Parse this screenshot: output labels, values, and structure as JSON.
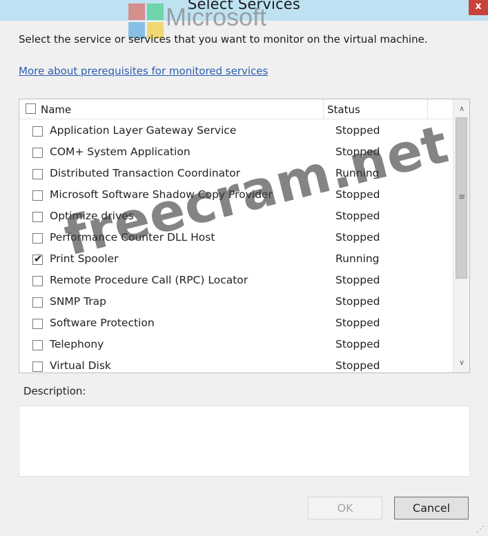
{
  "window": {
    "title": "Select Services"
  },
  "logo": {
    "wordmark": "Microsoft"
  },
  "prompt_text": "Select the service or services that you want to monitor on the virtual machine.",
  "prereq_link": "More about prerequisites for monitored services",
  "list": {
    "columns": {
      "name": "Name",
      "status": "Status"
    },
    "rows": [
      {
        "name": "Application Layer Gateway Service",
        "status": "Stopped",
        "checked": false
      },
      {
        "name": "COM+ System Application",
        "status": "Stopped",
        "checked": false
      },
      {
        "name": "Distributed Transaction Coordinator",
        "status": "Running",
        "checked": false
      },
      {
        "name": "Microsoft Software Shadow Copy Provider",
        "status": "Stopped",
        "checked": false
      },
      {
        "name": "Optimize drives",
        "status": "Stopped",
        "checked": false
      },
      {
        "name": "Performance Counter DLL Host",
        "status": "Stopped",
        "checked": false
      },
      {
        "name": "Print Spooler",
        "status": "Running",
        "checked": true
      },
      {
        "name": "Remote Procedure Call (RPC) Locator",
        "status": "Stopped",
        "checked": false
      },
      {
        "name": "SNMP Trap",
        "status": "Stopped",
        "checked": false
      },
      {
        "name": "Software Protection",
        "status": "Stopped",
        "checked": false
      },
      {
        "name": "Telephony",
        "status": "Stopped",
        "checked": false
      },
      {
        "name": "Virtual Disk",
        "status": "Stopped",
        "checked": false
      }
    ]
  },
  "description_label": "Description:",
  "buttons": {
    "ok": "OK",
    "cancel": "Cancel"
  },
  "watermark": "freecram.net",
  "icons": {
    "close": "close-icon",
    "scroll_up": "chevron-up-icon",
    "scroll_down": "chevron-down-icon"
  },
  "colors": {
    "titlebar": "#bfe2f2",
    "close_button": "#c9413b",
    "link": "#2a5db0",
    "logo": [
      "#e74c3c",
      "#2ecc71",
      "#3498db",
      "#f1c40f"
    ]
  }
}
